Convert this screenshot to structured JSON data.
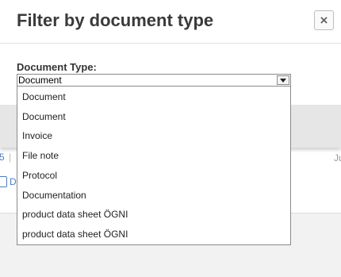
{
  "modal": {
    "title": "Filter by document type",
    "close_symbol": "×"
  },
  "field": {
    "label": "Document Type:",
    "selected": "Document"
  },
  "dropdown": {
    "options": [
      "Document",
      "Document",
      "Invoice",
      "File note",
      "Protocol",
      "Documentation",
      "product data sheet ÖGNI",
      "product data sheet ÖGNI"
    ]
  },
  "background": {
    "count_fragment": "5",
    "separator": "|",
    "right_fragment": "Ju",
    "doc_link_fragment": "D"
  },
  "colors": {
    "link": "#4a7fc1",
    "title": "#3a3a3a",
    "footer_bg": "#e6e6e6"
  }
}
